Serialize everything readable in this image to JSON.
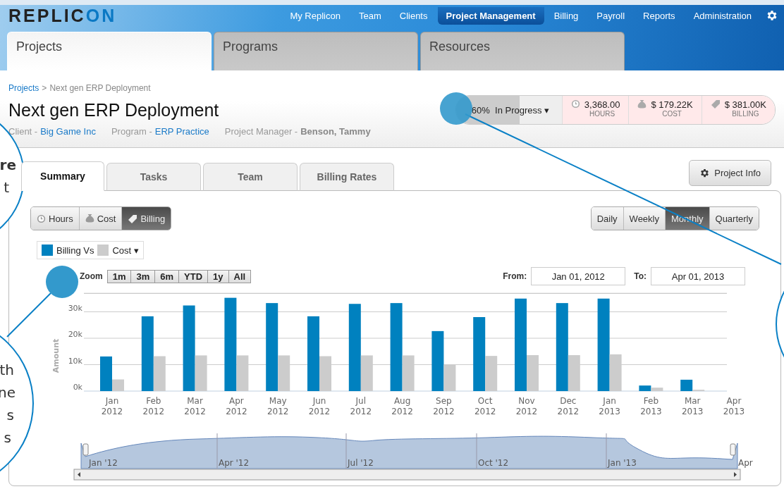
{
  "logo": {
    "main": "REPLIC",
    "accent": "ON"
  },
  "nav": [
    {
      "label": "My Replicon",
      "selected": false
    },
    {
      "label": "Team",
      "selected": false
    },
    {
      "label": "Clients",
      "selected": false
    },
    {
      "label": "Project Management",
      "selected": true
    },
    {
      "label": "Billing",
      "selected": false
    },
    {
      "label": "Payroll",
      "selected": false
    },
    {
      "label": "Reports",
      "selected": false
    },
    {
      "label": "Administration",
      "selected": false
    }
  ],
  "main_tabs": [
    {
      "label": "Projects",
      "selected": true
    },
    {
      "label": "Programs",
      "selected": false
    },
    {
      "label": "Resources",
      "selected": false
    }
  ],
  "breadcrumb": {
    "link": "Projects",
    "separator": ">",
    "current": "Next gen ERP Deployment"
  },
  "project": {
    "title": "Next gen ERP Deployment",
    "meta": [
      {
        "label": "Client -",
        "value": "Big Game Inc",
        "kind": "link"
      },
      {
        "label": "Program -",
        "value": "ERP Practice",
        "kind": "link"
      },
      {
        "label": "Project Manager -",
        "value": "Benson, Tammy",
        "kind": "bold"
      }
    ]
  },
  "status": {
    "percent": "60%",
    "level": 0.6,
    "state": "In Progress",
    "caret": "▾",
    "metrics": [
      {
        "value": "3,368.00",
        "label": "HOURS"
      },
      {
        "value": "$ 179.22K",
        "label": "COST"
      },
      {
        "value": "$ 381.00K",
        "label": "BILLING"
      }
    ]
  },
  "sub_tabs": [
    {
      "label": "Summary",
      "selected": true
    },
    {
      "label": "Tasks",
      "selected": false
    },
    {
      "label": "Team",
      "selected": false
    },
    {
      "label": "Billing Rates",
      "selected": false
    }
  ],
  "project_info_button": "Project Info",
  "measure_toggle": [
    {
      "label": "Hours",
      "selected": false
    },
    {
      "label": "Cost",
      "selected": false
    },
    {
      "label": "Billing",
      "selected": true
    }
  ],
  "period_toggle": [
    {
      "label": "Daily",
      "selected": false
    },
    {
      "label": "Weekly",
      "selected": false
    },
    {
      "label": "Monthly",
      "selected": true
    },
    {
      "label": "Quarterly",
      "selected": false
    }
  ],
  "legend": {
    "joiner": "Vs",
    "caret": "▾"
  },
  "zoom": {
    "label": "Zoom",
    "buttons": [
      "1m",
      "3m",
      "6m",
      "YTD",
      "1y",
      "All"
    ]
  },
  "range": {
    "from_label": "From:",
    "from": "Jan 01, 2012",
    "to_label": "To:",
    "to": "Apr 01, 2013"
  },
  "chart_data": {
    "type": "bar",
    "ylabel": "Amount",
    "categories": [
      "Jan 2012",
      "Feb 2012",
      "Mar 2012",
      "Apr 2012",
      "May 2012",
      "Jun 2012",
      "Jul 2012",
      "Aug 2012",
      "Sep 2012",
      "Oct 2012",
      "Nov 2012",
      "Dec 2012",
      "Jan 2013",
      "Feb 2013",
      "Mar 2013",
      "Apr 2013"
    ],
    "series": [
      {
        "name": "Billing",
        "color": "#0081bf",
        "values": [
          13100,
          28300,
          32400,
          35300,
          33300,
          28300,
          33000,
          33300,
          22700,
          28000,
          35000,
          33300,
          35000,
          2100,
          4300,
          null
        ]
      },
      {
        "name": "Cost",
        "color": "#cccccc",
        "values": [
          4400,
          13200,
          13500,
          13500,
          13500,
          13200,
          13500,
          13500,
          10100,
          13300,
          13600,
          13600,
          13900,
          1300,
          500,
          null
        ]
      }
    ],
    "ylim": [
      0,
      37000
    ],
    "grid": true,
    "yticks": [
      {
        "value": 0,
        "label": "0k"
      },
      {
        "value": 10000,
        "label": "10k"
      },
      {
        "value": 20000,
        "label": "20k"
      },
      {
        "value": 30000,
        "label": "30k"
      }
    ]
  },
  "navigator": {
    "labels": [
      "Jan '12",
      "Apr '12",
      "Jul '12",
      "Oct '12",
      "Jan '13",
      "Apr"
    ]
  },
  "callouts": [
    {
      "lines": [
        {
          "text": "re",
          "bold": true
        },
        {
          "text": "t",
          "bold": false
        }
      ]
    },
    {
      "lines": [
        {
          "text": "th",
          "bold": false
        },
        {
          "text": "ne",
          "bold": false
        },
        {
          "text": "s",
          "bold": false
        },
        {
          "text": "s",
          "bold": false
        }
      ]
    }
  ]
}
